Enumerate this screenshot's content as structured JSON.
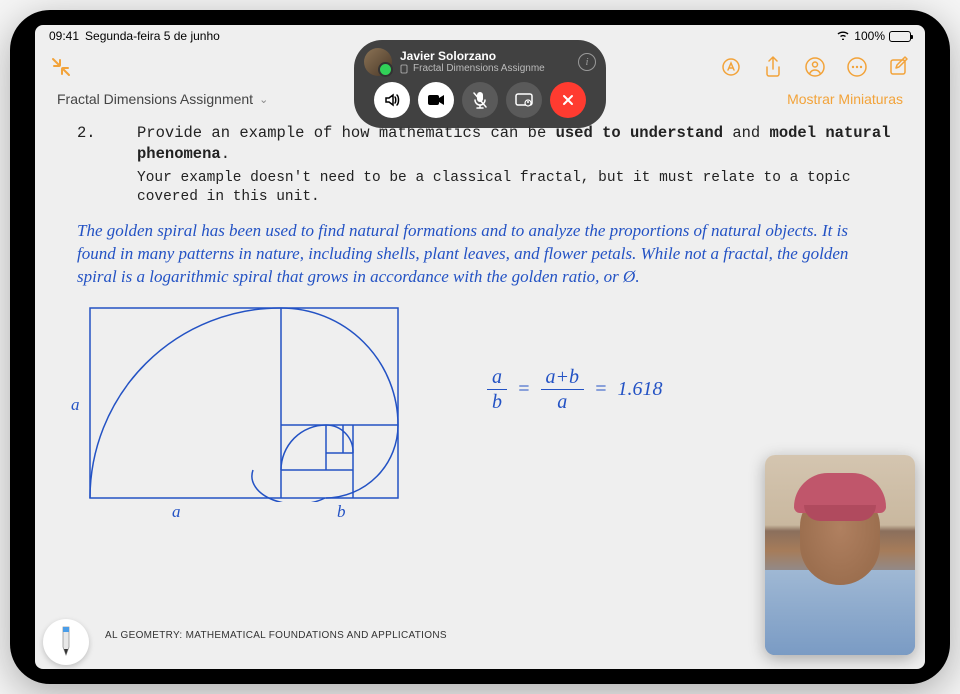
{
  "status": {
    "time": "09:41",
    "date": "Segunda-feira 5 de junho",
    "battery": "100%"
  },
  "toolbar": {
    "thumbnails_label": "Mostrar Miniaturas"
  },
  "document": {
    "title": "Fractal Dimensions Assignment",
    "question_number": "2.",
    "question_main_prefix": "Provide an example of how mathematics can be ",
    "question_bold1": "used to understand",
    "question_mid": " and ",
    "question_bold2": "model natural phenomena",
    "question_end": ".",
    "question_sub": "Your example doesn't need to be a classical fractal, but it must relate to a topic covered in this unit.",
    "handwritten": "The golden spiral has been used to find natural formations and to analyze the proportions of natural objects. It is found in many patterns in nature, including shells, plant leaves, and flower petals. While not a fractal, the golden spiral is a logarithmic spiral that grows in accordance with the golden ratio, or Ø.",
    "label_a": "a",
    "label_b": "b",
    "eq_a": "a",
    "eq_b": "b",
    "eq_apb": "a+b",
    "eq_eq": "=",
    "eq_val": "1.618",
    "footer": "AL GEOMETRY: MATHEMATICAL FOUNDATIONS AND APPLICATIONS"
  },
  "facetime": {
    "name": "Javier Solorzano",
    "subtitle": "Fractal Dimensions Assignme",
    "info": "i"
  }
}
